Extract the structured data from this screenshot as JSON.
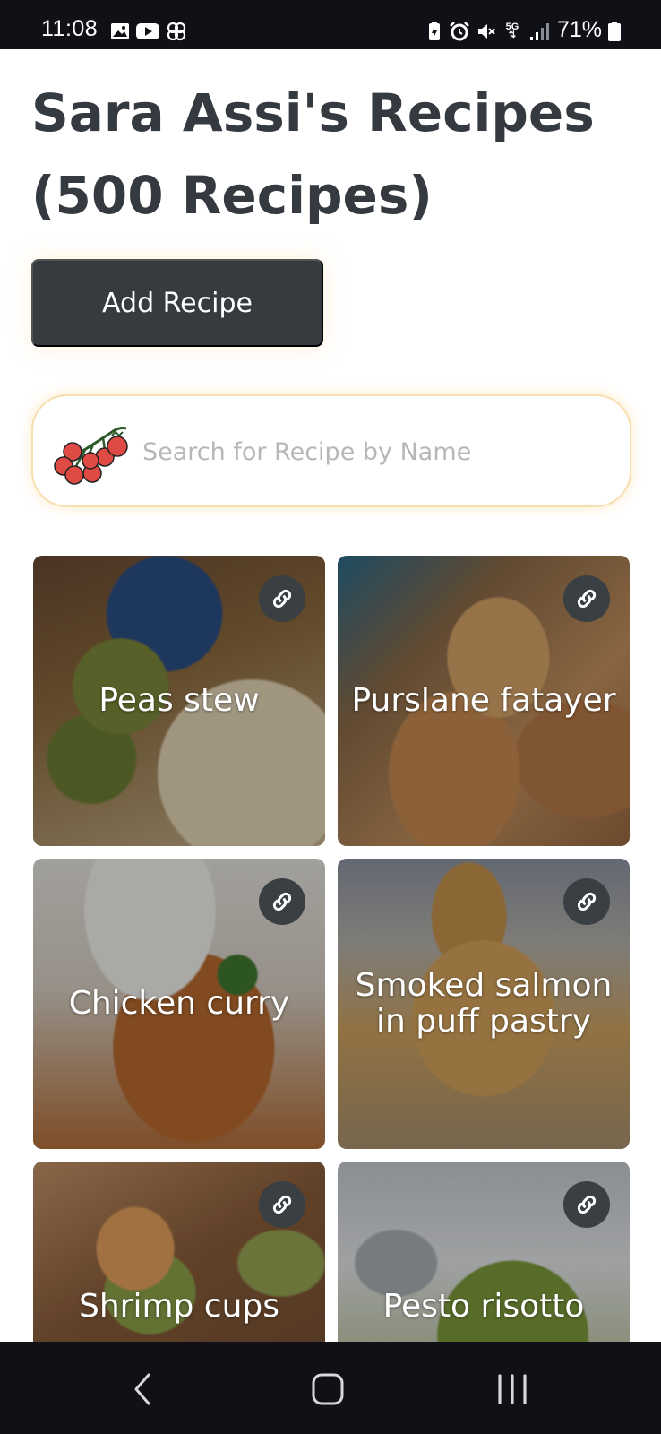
{
  "status_bar": {
    "time": "11:08",
    "battery": "71%",
    "left_icons": [
      "gallery-icon",
      "youtube-icon",
      "pinwheel-icon"
    ],
    "right_icons": [
      "battery-saver-icon",
      "alarm-icon",
      "mute-icon",
      "5g-icon",
      "signal-icon",
      "battery-icon"
    ]
  },
  "header": {
    "title": "Sara Assi's Recipes (500 Recipes)"
  },
  "add_button": {
    "label": "Add Recipe"
  },
  "search": {
    "placeholder": "Search for Recipe by Name",
    "value": ""
  },
  "recipes": [
    {
      "name": "Peas stew"
    },
    {
      "name": "Purslane fatayer"
    },
    {
      "name": "Chicken curry"
    },
    {
      "name": "Smoked salmon in puff pastry"
    },
    {
      "name": "Shrimp cups"
    },
    {
      "name": "Pesto risotto"
    }
  ],
  "colors": {
    "accent": "#363b40",
    "search_glow": "#f7deaf",
    "system_bar": "#0f1117"
  }
}
